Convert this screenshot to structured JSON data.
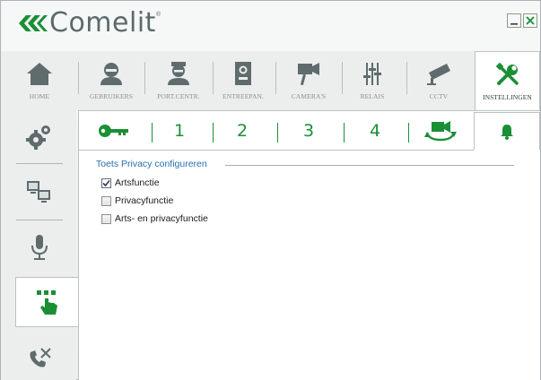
{
  "app": {
    "logo_text": "Comelit",
    "logo_mark": "®"
  },
  "window_controls": {
    "minimize_label": "_",
    "close_label": "X"
  },
  "topnav": {
    "items": [
      {
        "label": "HOME",
        "icon": "home-icon"
      },
      {
        "label": "GEBRUIKERS",
        "icon": "user-icon"
      },
      {
        "label": "PORT.CENTR.",
        "icon": "concierge-icon"
      },
      {
        "label": "ENTREEPAN.",
        "icon": "entrance-panel-icon"
      },
      {
        "label": "CAMERA'S",
        "icon": "camera-icon"
      },
      {
        "label": "RELAIS",
        "icon": "relay-sliders-icon"
      },
      {
        "label": "CCTV",
        "icon": "cctv-icon"
      },
      {
        "label": "INSTELLINGEN",
        "icon": "settings-tools-icon",
        "active": true
      }
    ]
  },
  "sidebar": {
    "items": [
      {
        "icon": "gears-icon"
      },
      {
        "icon": "network-computers-icon"
      },
      {
        "icon": "microphone-icon"
      },
      {
        "icon": "touch-keypad-icon",
        "active": true
      },
      {
        "icon": "phone-settings-icon"
      }
    ]
  },
  "subtabs": {
    "items": [
      {
        "label": "",
        "icon": "key-icon"
      },
      {
        "label": "1"
      },
      {
        "label": "2"
      },
      {
        "label": "3"
      },
      {
        "label": "4"
      },
      {
        "label": "",
        "icon": "camera-cycle-icon"
      },
      {
        "label": "",
        "icon": "bell-icon",
        "active": true
      }
    ]
  },
  "group": {
    "title": "Toets Privacy configureren",
    "options": [
      {
        "label": "Artsfunctie",
        "checked": true
      },
      {
        "label": "Privacyfunctie",
        "checked": false
      },
      {
        "label": "Arts- en privacyfunctie",
        "checked": false
      }
    ]
  },
  "colors": {
    "accent_green": "#1a8f36",
    "icon_gray": "#5f6b6c",
    "group_title_blue": "#2a6fb0"
  }
}
